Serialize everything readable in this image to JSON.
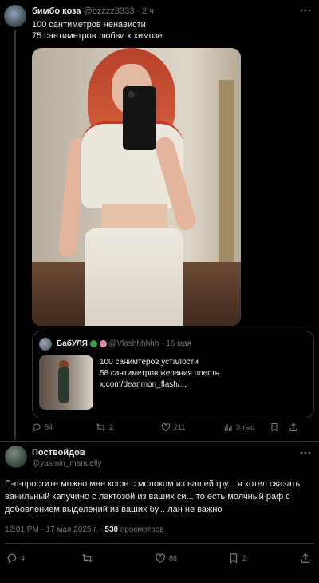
{
  "tweet1": {
    "author_name": "бимбо коза",
    "author_handle": "@bzzzz3333",
    "dot": "·",
    "time": "2 ч",
    "text_line1": "100 сантиметров ненависти",
    "text_line2": "75 сантиметров любви к химозе",
    "quote": {
      "author_name": "БабУЛЯ",
      "author_handle": "@Vlashhhhhh",
      "dot": "·",
      "date": "16 мая",
      "text_line1": "100 санимтеров усталости",
      "text_line2": "58 сантиметров желания поесть",
      "text_line3": "x.com/deanmon_flash/..."
    },
    "stats": {
      "replies": "54",
      "reposts": "2",
      "likes": "211",
      "views": "3 тыс."
    }
  },
  "tweet2": {
    "author_name": "Поствойдов",
    "author_handle": "@yasmin_manuelly",
    "text": "П-п-простите можно мне кофе с молоком из вашей гру... я хотел сказать ванильный капучино с лактозой из ваших си... то есть молчный раф с добовлением выделений из ваших бу... лан не важно",
    "time": "12:01 PM",
    "dot": "·",
    "date": "17 мая 2025 г.",
    "views_count": "530",
    "views_label": "просмотров",
    "stats": {
      "replies": "4",
      "likes": "86",
      "bookmarks": "2"
    }
  },
  "colors": {
    "background": "#000000",
    "text": "#e7e9ea",
    "muted": "#71767b",
    "divider": "#2f3336"
  }
}
